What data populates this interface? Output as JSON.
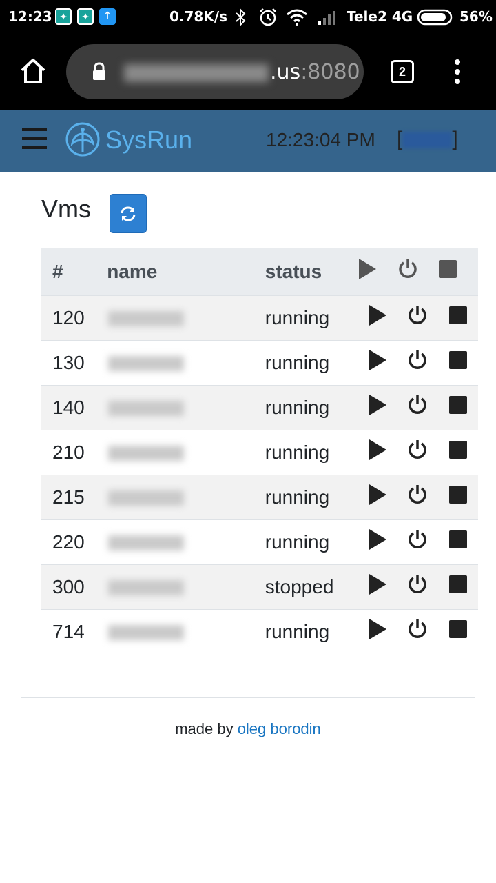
{
  "statusbar": {
    "time": "12:23",
    "speed": "0.78K/s",
    "carrier": "Tele2 4G",
    "battery": "56%"
  },
  "browser": {
    "url_suffix": ".us",
    "url_port": ":8080",
    "tab_count": "2"
  },
  "navbar": {
    "brand": "SysRun",
    "clock": "12:23:04 PM",
    "user_open": "[",
    "user_close": "]"
  },
  "page": {
    "title": "Vms"
  },
  "table": {
    "headers": {
      "num": "#",
      "name": "name",
      "status": "status"
    },
    "rows": [
      {
        "num": "120",
        "status": "running"
      },
      {
        "num": "130",
        "status": "running"
      },
      {
        "num": "140",
        "status": "running"
      },
      {
        "num": "210",
        "status": "running"
      },
      {
        "num": "215",
        "status": "running"
      },
      {
        "num": "220",
        "status": "running"
      },
      {
        "num": "300",
        "status": "stopped"
      },
      {
        "num": "714",
        "status": "running"
      }
    ]
  },
  "footer": {
    "text": "made by ",
    "author": "oleg borodin"
  },
  "colors": {
    "navbar_bg": "#35648c",
    "brand": "#5ab1ec",
    "refresh_button": "#2d80d2",
    "link": "#1a76c2"
  }
}
